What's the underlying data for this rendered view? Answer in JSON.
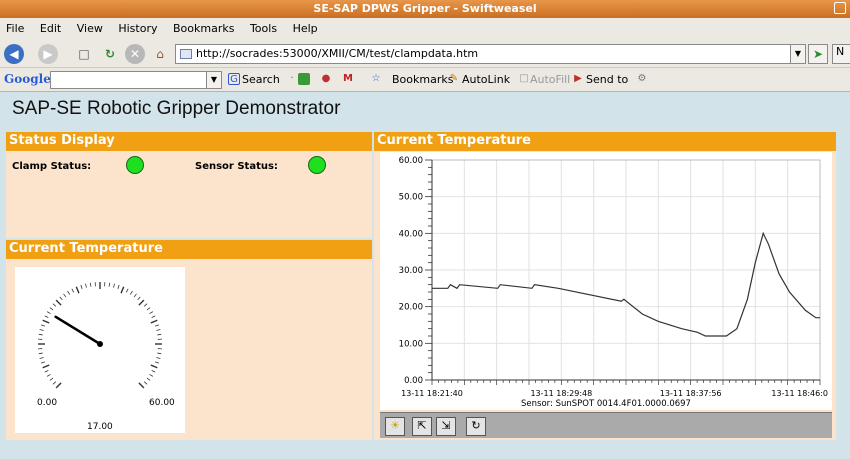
{
  "window": {
    "title": "SE-SAP DPWS Gripper - Swiftweasel"
  },
  "menu": [
    {
      "label": "File"
    },
    {
      "label": "Edit"
    },
    {
      "label": "View"
    },
    {
      "label": "History"
    },
    {
      "label": "Bookmarks"
    },
    {
      "label": "Tools"
    },
    {
      "label": "Help"
    }
  ],
  "nav": {
    "url": "http://socrades:53000/XMII/CM/test/clampdata.htm"
  },
  "googlebar": {
    "logo": "Google",
    "search_label": "Search",
    "bookmarks_label": "Bookmarks",
    "autolink_label": "AutoLink",
    "autofill_label": "AutoFill",
    "sendto_label": "Send to"
  },
  "page": {
    "title": "SAP-SE Robotic Gripper Demonstrator",
    "status_panel": {
      "heading": "Status Display",
      "clamp_label": "Clamp Status:",
      "sensor_label": "Sensor Status:",
      "clamp_color": "#1fe01f",
      "sensor_color": "#1fe01f"
    },
    "gauge_panel": {
      "heading": "Current Temperature",
      "min_label": "0.00",
      "max_label": "60.00",
      "value_label": "17.00",
      "min": 0,
      "max": 60,
      "value": 17
    },
    "chart_panel": {
      "heading": "Current Temperature"
    }
  },
  "chart_data": {
    "type": "line",
    "ylim": [
      0,
      60
    ],
    "y_ticks": [
      "0.00",
      "10.00",
      "20.00",
      "30.00",
      "40.00",
      "50.00",
      "60.00"
    ],
    "x_ticks": [
      "13-11 18:21:40",
      "13-11 18:29:48",
      "13-11 18:37:56",
      "13-11 18:46:0"
    ],
    "xlabel": "Sensor: SunSPOT 0014.4F01.0000.0697",
    "xlim": [
      0,
      1476
    ],
    "series": [
      {
        "x": [
          0,
          60,
          70,
          95,
          105,
          250,
          260,
          380,
          390,
          480,
          720,
          730,
          800,
          860,
          950,
          1010,
          1040,
          1080,
          1120,
          1160,
          1200,
          1230,
          1260,
          1280,
          1290,
          1320,
          1360,
          1420,
          1460,
          1476
        ],
        "y": [
          25,
          25,
          26,
          25,
          26,
          25,
          26,
          25,
          26,
          25,
          21.5,
          22,
          18,
          16,
          14,
          13,
          12,
          12,
          12,
          14,
          22,
          32,
          40,
          37,
          35,
          29,
          24,
          19,
          17,
          17
        ]
      }
    ]
  },
  "toolbar_icons": [
    "light-icon",
    "zoom-in-icon",
    "zoom-out-icon",
    "refresh-icon"
  ]
}
